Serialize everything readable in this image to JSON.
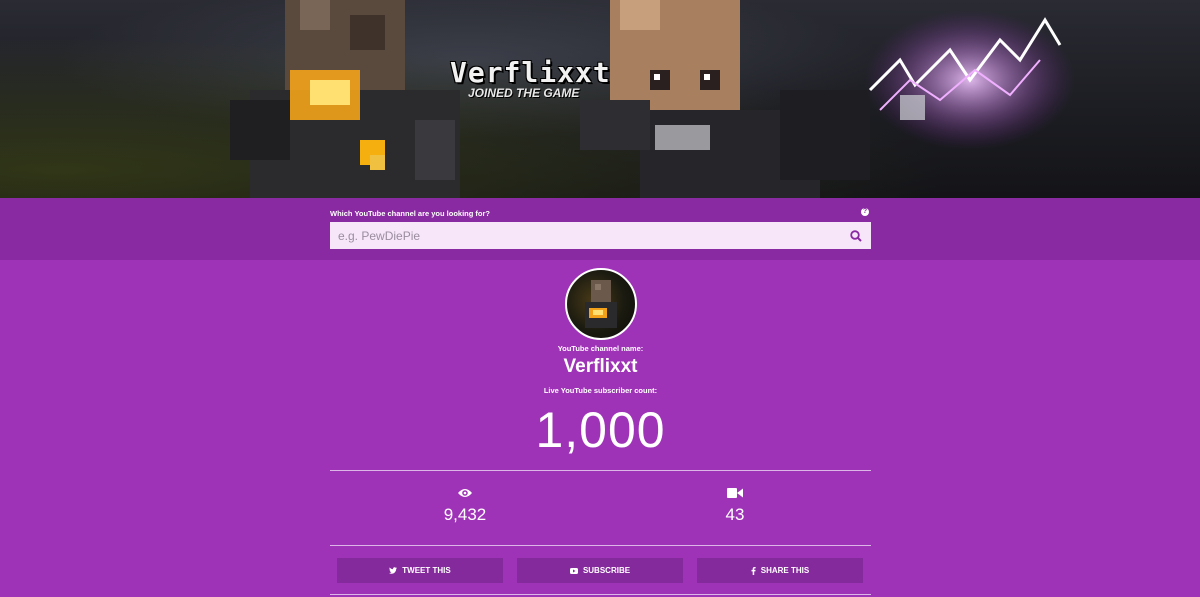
{
  "banner": {
    "title": "Verflixxt",
    "subtitle": "JOINED THE GAME"
  },
  "search": {
    "label": "Which YouTube channel are you looking for?",
    "placeholder": "e.g. PewDiePie",
    "help_glyph": "?"
  },
  "channel": {
    "name_label": "YouTube channel name:",
    "name": "Verflixxt",
    "count_label": "Live YouTube subscriber count:",
    "subscriber_count": "1,000"
  },
  "stats": {
    "views": "9,432",
    "videos": "43"
  },
  "actions": {
    "tweet": "TWEET THIS",
    "subscribe": "SUBSCRIBE",
    "share": "SHARE THIS"
  },
  "colors": {
    "background": "#9f33b7",
    "search_band": "#8a2aa2",
    "button": "#852a9d",
    "search_box": "#f7e6fa"
  },
  "icons": {
    "views": "eye-icon",
    "videos": "video-camera-icon",
    "search": "search-icon",
    "tweet": "twitter-icon",
    "subscribe": "youtube-icon",
    "share": "facebook-icon"
  }
}
